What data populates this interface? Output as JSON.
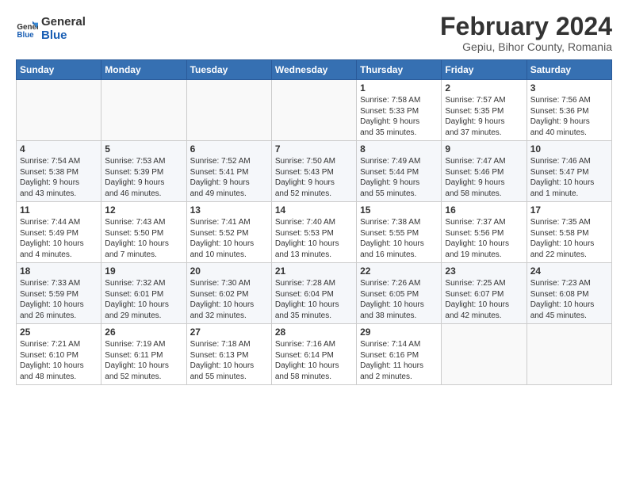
{
  "logo": {
    "line1": "General",
    "line2": "Blue"
  },
  "title": "February 2024",
  "subtitle": "Gepiu, Bihor County, Romania",
  "headers": [
    "Sunday",
    "Monday",
    "Tuesday",
    "Wednesday",
    "Thursday",
    "Friday",
    "Saturday"
  ],
  "weeks": [
    [
      {
        "day": "",
        "info": ""
      },
      {
        "day": "",
        "info": ""
      },
      {
        "day": "",
        "info": ""
      },
      {
        "day": "",
        "info": ""
      },
      {
        "day": "1",
        "info": "Sunrise: 7:58 AM\nSunset: 5:33 PM\nDaylight: 9 hours\nand 35 minutes."
      },
      {
        "day": "2",
        "info": "Sunrise: 7:57 AM\nSunset: 5:35 PM\nDaylight: 9 hours\nand 37 minutes."
      },
      {
        "day": "3",
        "info": "Sunrise: 7:56 AM\nSunset: 5:36 PM\nDaylight: 9 hours\nand 40 minutes."
      }
    ],
    [
      {
        "day": "4",
        "info": "Sunrise: 7:54 AM\nSunset: 5:38 PM\nDaylight: 9 hours\nand 43 minutes."
      },
      {
        "day": "5",
        "info": "Sunrise: 7:53 AM\nSunset: 5:39 PM\nDaylight: 9 hours\nand 46 minutes."
      },
      {
        "day": "6",
        "info": "Sunrise: 7:52 AM\nSunset: 5:41 PM\nDaylight: 9 hours\nand 49 minutes."
      },
      {
        "day": "7",
        "info": "Sunrise: 7:50 AM\nSunset: 5:43 PM\nDaylight: 9 hours\nand 52 minutes."
      },
      {
        "day": "8",
        "info": "Sunrise: 7:49 AM\nSunset: 5:44 PM\nDaylight: 9 hours\nand 55 minutes."
      },
      {
        "day": "9",
        "info": "Sunrise: 7:47 AM\nSunset: 5:46 PM\nDaylight: 9 hours\nand 58 minutes."
      },
      {
        "day": "10",
        "info": "Sunrise: 7:46 AM\nSunset: 5:47 PM\nDaylight: 10 hours\nand 1 minute."
      }
    ],
    [
      {
        "day": "11",
        "info": "Sunrise: 7:44 AM\nSunset: 5:49 PM\nDaylight: 10 hours\nand 4 minutes."
      },
      {
        "day": "12",
        "info": "Sunrise: 7:43 AM\nSunset: 5:50 PM\nDaylight: 10 hours\nand 7 minutes."
      },
      {
        "day": "13",
        "info": "Sunrise: 7:41 AM\nSunset: 5:52 PM\nDaylight: 10 hours\nand 10 minutes."
      },
      {
        "day": "14",
        "info": "Sunrise: 7:40 AM\nSunset: 5:53 PM\nDaylight: 10 hours\nand 13 minutes."
      },
      {
        "day": "15",
        "info": "Sunrise: 7:38 AM\nSunset: 5:55 PM\nDaylight: 10 hours\nand 16 minutes."
      },
      {
        "day": "16",
        "info": "Sunrise: 7:37 AM\nSunset: 5:56 PM\nDaylight: 10 hours\nand 19 minutes."
      },
      {
        "day": "17",
        "info": "Sunrise: 7:35 AM\nSunset: 5:58 PM\nDaylight: 10 hours\nand 22 minutes."
      }
    ],
    [
      {
        "day": "18",
        "info": "Sunrise: 7:33 AM\nSunset: 5:59 PM\nDaylight: 10 hours\nand 26 minutes."
      },
      {
        "day": "19",
        "info": "Sunrise: 7:32 AM\nSunset: 6:01 PM\nDaylight: 10 hours\nand 29 minutes."
      },
      {
        "day": "20",
        "info": "Sunrise: 7:30 AM\nSunset: 6:02 PM\nDaylight: 10 hours\nand 32 minutes."
      },
      {
        "day": "21",
        "info": "Sunrise: 7:28 AM\nSunset: 6:04 PM\nDaylight: 10 hours\nand 35 minutes."
      },
      {
        "day": "22",
        "info": "Sunrise: 7:26 AM\nSunset: 6:05 PM\nDaylight: 10 hours\nand 38 minutes."
      },
      {
        "day": "23",
        "info": "Sunrise: 7:25 AM\nSunset: 6:07 PM\nDaylight: 10 hours\nand 42 minutes."
      },
      {
        "day": "24",
        "info": "Sunrise: 7:23 AM\nSunset: 6:08 PM\nDaylight: 10 hours\nand 45 minutes."
      }
    ],
    [
      {
        "day": "25",
        "info": "Sunrise: 7:21 AM\nSunset: 6:10 PM\nDaylight: 10 hours\nand 48 minutes."
      },
      {
        "day": "26",
        "info": "Sunrise: 7:19 AM\nSunset: 6:11 PM\nDaylight: 10 hours\nand 52 minutes."
      },
      {
        "day": "27",
        "info": "Sunrise: 7:18 AM\nSunset: 6:13 PM\nDaylight: 10 hours\nand 55 minutes."
      },
      {
        "day": "28",
        "info": "Sunrise: 7:16 AM\nSunset: 6:14 PM\nDaylight: 10 hours\nand 58 minutes."
      },
      {
        "day": "29",
        "info": "Sunrise: 7:14 AM\nSunset: 6:16 PM\nDaylight: 11 hours\nand 2 minutes."
      },
      {
        "day": "",
        "info": ""
      },
      {
        "day": "",
        "info": ""
      }
    ]
  ]
}
